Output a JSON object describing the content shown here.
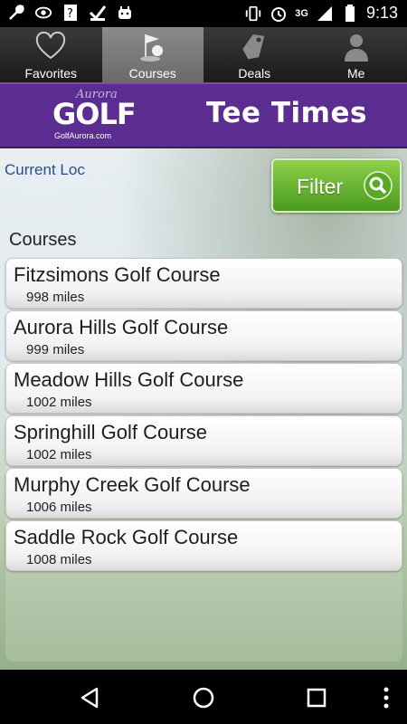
{
  "status_bar": {
    "network": "3G",
    "time": "9:13",
    "left_icons": [
      "wrench-icon",
      "eye-icon",
      "question-icon",
      "check-icon",
      "android-icon"
    ],
    "right_icons": [
      "vibrate-icon",
      "alarm-icon",
      "signal-icon",
      "battery-icon"
    ]
  },
  "tabs": [
    {
      "label": "Favorites",
      "icon": "heart-icon",
      "active": false
    },
    {
      "label": "Courses",
      "icon": "golf-flag-icon",
      "active": true
    },
    {
      "label": "Deals",
      "icon": "tag-icon",
      "active": false
    },
    {
      "label": "Me",
      "icon": "person-icon",
      "active": false
    }
  ],
  "banner": {
    "logo_script": "Aurora",
    "logo_word": "GOLF",
    "logo_url": "GolfAurora.com",
    "title": "Tee Times"
  },
  "location": {
    "label": "Current Loc"
  },
  "filter": {
    "label": "Filter",
    "icon": "search-icon"
  },
  "section_label": "Courses",
  "courses": [
    {
      "name": "Fitzsimons Golf Course",
      "distance": "998 miles"
    },
    {
      "name": "Aurora Hills Golf Course",
      "distance": "999 miles"
    },
    {
      "name": "Meadow Hills Golf Course",
      "distance": "1002 miles"
    },
    {
      "name": "Springhill Golf Course",
      "distance": "1002 miles"
    },
    {
      "name": "Murphy Creek Golf Course",
      "distance": "1006 miles"
    },
    {
      "name": "Saddle Rock Golf Course",
      "distance": "1008 miles"
    }
  ],
  "nav": [
    "back-icon",
    "home-icon",
    "recents-icon",
    "more-icon"
  ],
  "colors": {
    "banner": "#5c2d91",
    "filter": "#6ab83a",
    "link": "#2a4f86"
  }
}
